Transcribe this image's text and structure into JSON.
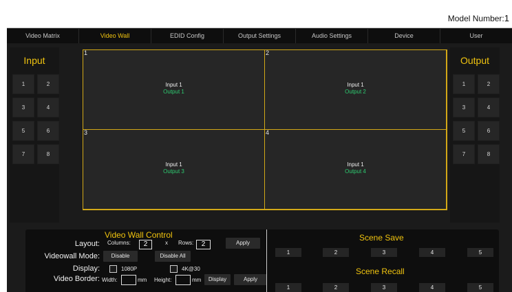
{
  "header": {
    "model_label": "Model Number:",
    "model_number": "1"
  },
  "nav": {
    "tabs": [
      {
        "label": "Video Matrix",
        "active": false
      },
      {
        "label": "Video Wall",
        "active": true
      },
      {
        "label": "EDID Config",
        "active": false
      },
      {
        "label": "Output Settings",
        "active": false
      },
      {
        "label": "Audio Settings",
        "active": false
      },
      {
        "label": "Device",
        "active": false
      },
      {
        "label": "User",
        "active": false
      }
    ]
  },
  "input_panel": {
    "title": "Input",
    "buttons": [
      "1",
      "2",
      "3",
      "4",
      "5",
      "6",
      "7",
      "8"
    ]
  },
  "output_panel": {
    "title": "Output",
    "buttons": [
      "1",
      "2",
      "3",
      "4",
      "5",
      "6",
      "7",
      "8"
    ]
  },
  "wall": {
    "cells": [
      {
        "number": "1",
        "input": "Input 1",
        "output": "Output 1"
      },
      {
        "number": "2",
        "input": "Input 1",
        "output": "Output 2"
      },
      {
        "number": "3",
        "input": "Input 1",
        "output": "Output 3"
      },
      {
        "number": "4",
        "input": "Input 1",
        "output": "Output 4"
      }
    ]
  },
  "control": {
    "title": "Video Wall Control",
    "layout_label": "Layout:",
    "columns_label": "Columns:",
    "columns_value": "2",
    "x_label": "x",
    "rows_label": "Rows:",
    "rows_value": "2",
    "apply_label": "Apply",
    "videowall_mode_label": "Videowall Mode:",
    "disable_label": "Disable",
    "disable_all_label": "Disable All",
    "display_label": "Display:",
    "opt_1080p": "1080P",
    "opt_4k30": "4K@30",
    "video_border_label": "Video Border:",
    "width_label": "Width:",
    "mm_label": "mm",
    "height_label": "Height:",
    "display_button_label": "Display",
    "apply2_label": "Apply"
  },
  "scenes": {
    "save_title": "Scene Save",
    "save_buttons": [
      "1",
      "2",
      "3",
      "4",
      "5"
    ],
    "recall_title": "Scene Recall",
    "recall_buttons": [
      "1",
      "2",
      "3",
      "4",
      "5"
    ]
  },
  "colors": {
    "accent": "#f1c40f",
    "output_text": "#2ecc71",
    "background": "#1b1b1b",
    "panel": "#0e0e0e"
  }
}
